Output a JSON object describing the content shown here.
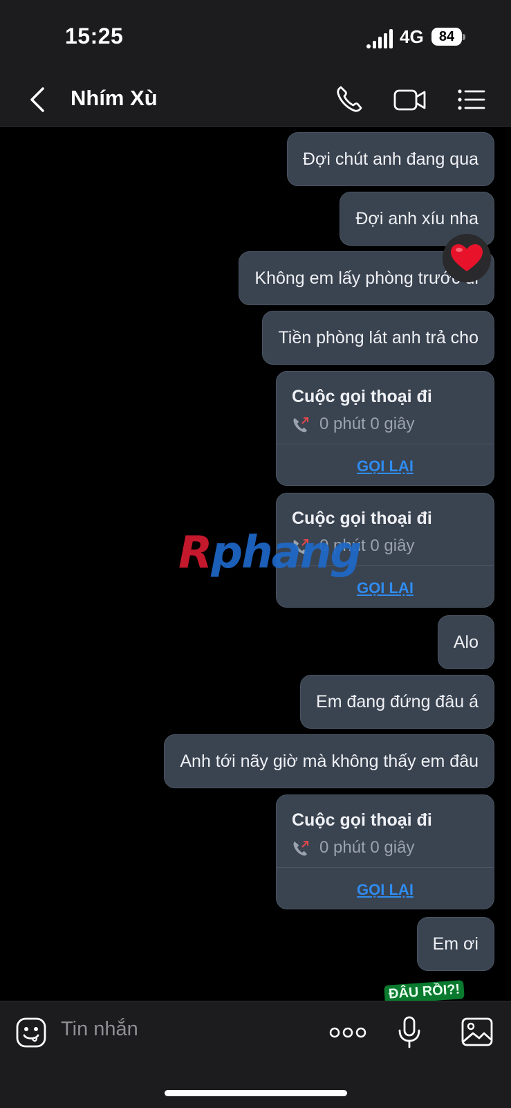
{
  "status": {
    "time": "15:25",
    "network": "4G",
    "battery": "84"
  },
  "header": {
    "title": "Nhím Xù"
  },
  "messages": {
    "m1": "Đợi chút anh đang qua",
    "m2": "Đợi anh xíu nha",
    "m3": "Không em lấy phòng trước đi",
    "m4": "Tiền phòng lát anh trả cho",
    "m5": "Alo",
    "m6": "Em đang đứng đâu á",
    "m7": "Anh tới nãy giờ mà không thấy em đâu",
    "m8": "Em ơi"
  },
  "call": {
    "title": "Cuộc gọi thoại đi",
    "duration": "0 phút 0 giây",
    "redial": "GỌI LẠI"
  },
  "reaction": {
    "emoji": "❤️"
  },
  "watermark": {
    "first": "R",
    "rest": "phang"
  },
  "sticker": {
    "text": "ĐÂU RỒI?!"
  },
  "composer": {
    "placeholder": "Tin nhắn"
  },
  "colors": {
    "bubble": "#3a4350",
    "link": "#2f8cf0",
    "missed_arrow": "#e0484c"
  }
}
